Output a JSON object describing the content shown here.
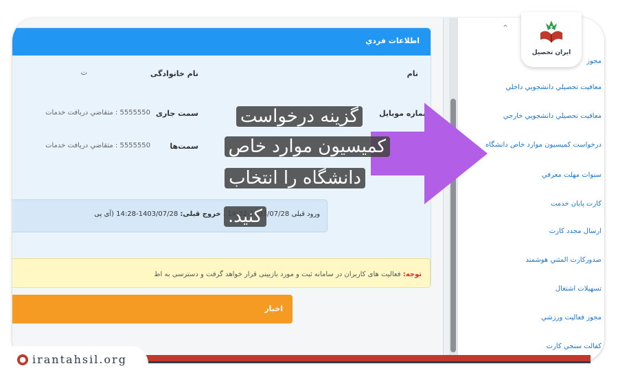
{
  "card": {
    "title": "اطلاعات فردي",
    "rows": [
      {
        "label": "نام",
        "second_label": "نام خانوادگی",
        "second_value": "ت"
      },
      {
        "label": "شماره موبايل",
        "second_label": "سمت جاری",
        "second_value": "5555550 : متقاضي دريافت خدمات"
      },
      {
        "label": "",
        "second_label": "سمت‌ها",
        "second_value": "5555550 : متقاضي دريافت خدمات"
      }
    ],
    "login_label": "ورود قبلی",
    "login_value": "1403/07/28-14:32",
    "logout_label": "خروج قبلی:",
    "logout_value": "1403/07/28-14:28 (آی پی",
    "note_label": "توجه:",
    "note_text": "فعاليت هاى كاربران در سامانه ثبت و مورد بازبينى قرار خواهد گرفت و دسترسى به اط"
  },
  "orange_bar": {
    "label": "اخبار"
  },
  "sidebar": {
    "items": [
      "مجوز",
      "معافيت تحصيلي دانشجويي داخلي",
      "معافيت تحصيلي دانشجويي خارجي",
      "درخواست كميسيون موارد خاص دانشگاه",
      "سنوات مهلت معرفي",
      "كارت پايان خدمت",
      "ارسال مجدد كارت",
      "صدوركارت المثني هوشمند",
      "تسهيلات اشتغال",
      "مجوز فعاليت ورزشي",
      "كفالت سنجي كارت"
    ]
  },
  "callout": {
    "lines": [
      "گزینه درخواست",
      "کمیسیون موارد خاص",
      "دانشگاه را انتخاب",
      "کنید."
    ]
  },
  "logo": {
    "text": "ایران تحصیل"
  },
  "watermark": {
    "text": "irantahsil.org"
  },
  "colors": {
    "header": "#2196f3",
    "arrow": "#b35ee6",
    "orange": "#f59a23",
    "brand_red": "#c0392b"
  }
}
